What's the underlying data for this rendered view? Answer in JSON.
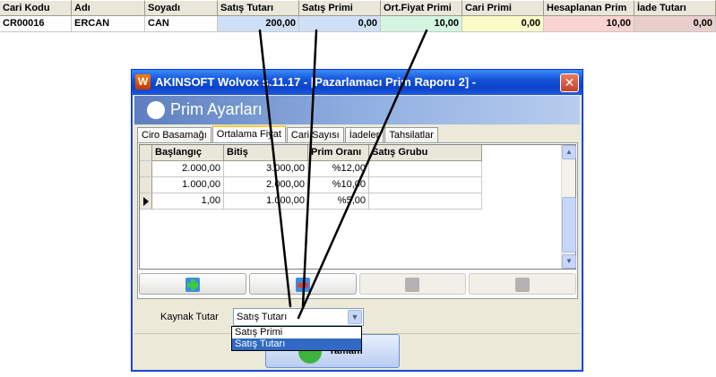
{
  "top_grid": {
    "columns": [
      {
        "label": "Cari Kodu",
        "width": 80
      },
      {
        "label": "Adı",
        "width": 82
      },
      {
        "label": "Soyadı",
        "width": 81
      },
      {
        "label": "Satış Tutarı",
        "width": 91
      },
      {
        "label": "Satış Primi",
        "width": 91
      },
      {
        "label": "Ort.Fiyat Primi",
        "width": 91
      },
      {
        "label": "Cari Primi",
        "width": 91
      },
      {
        "label": "Hesaplanan Prim",
        "width": 101
      },
      {
        "label": "İade Tutarı",
        "width": 91
      }
    ],
    "rows": [
      [
        "CR00016",
        "ERCAN",
        "CAN",
        "200,00",
        "0,00",
        "10,00",
        "0,00",
        "10,00",
        "0,00"
      ]
    ],
    "cell_colors": [
      "#ffffff",
      "#ffffff",
      "#ffffff",
      "#cfe0f6",
      "#cfe0f6",
      "#d4f5e0",
      "#fbfbc8",
      "#f9d3cf",
      "#e8cfcc"
    ]
  },
  "window": {
    "title": "AKINSOFT Wolvox s.11.17 - [Pazarlamacı Prim Raporu 2] -",
    "app_icon_letter": "W",
    "close_glyph": "✕",
    "banner_title": "Prim Ayarları",
    "tabs": [
      "Ciro Basamağı",
      "Ortalama Fiyat",
      "Cari Sayısı",
      "İadeler",
      "Tahsilatlar"
    ],
    "active_tab": 1,
    "grid": {
      "columns": [
        {
          "label": "Başlangıç",
          "width": 80
        },
        {
          "label": "Bitiş",
          "width": 94
        },
        {
          "label": "Prim Oranı",
          "width": 68
        },
        {
          "label": "Satış Grubu",
          "width": 126
        }
      ],
      "rows": [
        [
          "2.000,00",
          "3.000,00",
          "%12,00",
          ""
        ],
        [
          "1.000,00",
          "2.000,00",
          "%10,00",
          ""
        ],
        [
          "1,00",
          "1.000,00",
          "%5,00",
          ""
        ]
      ],
      "current_row": 2
    },
    "action_buttons": [
      {
        "name": "add-record-button",
        "icon": "plus-icon",
        "enabled": true
      },
      {
        "name": "delete-record-button",
        "icon": "minus-icon",
        "enabled": true
      },
      {
        "name": "edit-record-button",
        "icon": "edit-icon",
        "enabled": false
      },
      {
        "name": "next-record-button",
        "icon": "arrow-right-icon",
        "enabled": false
      }
    ],
    "kaynak_label": "Kaynak Tutar",
    "kaynak_value": "Satış Tutarı",
    "dropdown_options": [
      "Satış Primi",
      "Satış Tutarı"
    ],
    "dropdown_selected": 1,
    "ok_label": "Tamam"
  }
}
